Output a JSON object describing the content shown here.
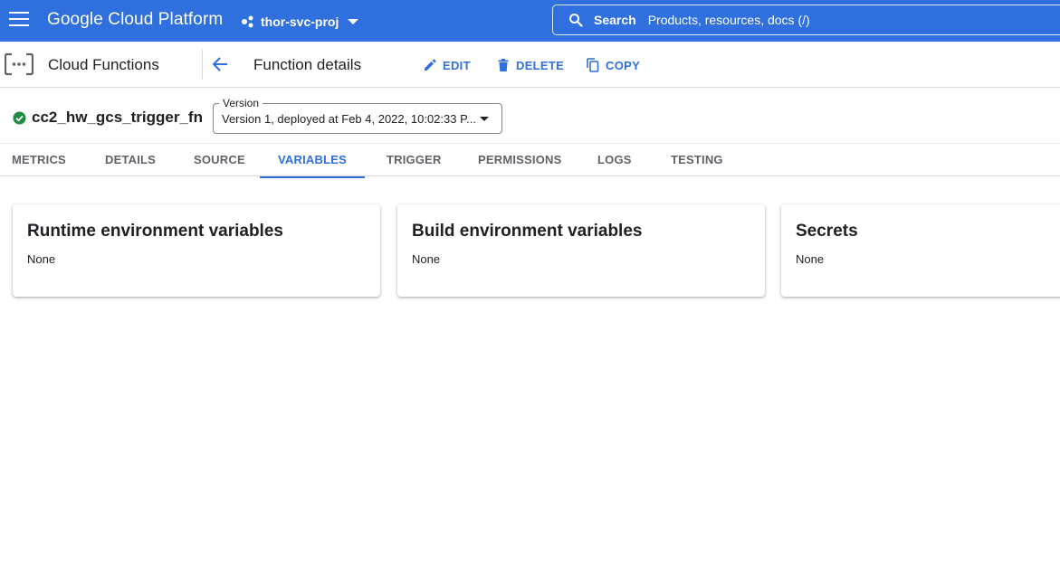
{
  "topbar": {
    "brand": "Google Cloud Platform",
    "project": "thor-svc-proj",
    "search_label": "Search",
    "search_placeholder": "Products, resources, docs (/)"
  },
  "subheader": {
    "product": "Cloud Functions",
    "page_title": "Function details",
    "actions": {
      "edit": "EDIT",
      "delete": "DELETE",
      "copy": "COPY"
    }
  },
  "function": {
    "name": "cc2_hw_gcs_trigger_fn",
    "version_label": "Version",
    "version_value": "Version 1, deployed at Feb 4, 2022, 10:02:33 P..."
  },
  "tabs": [
    "METRICS",
    "DETAILS",
    "SOURCE",
    "VARIABLES",
    "TRIGGER",
    "PERMISSIONS",
    "LOGS",
    "TESTING"
  ],
  "active_tab": "VARIABLES",
  "cards": [
    {
      "title": "Runtime environment variables",
      "value": "None"
    },
    {
      "title": "Build environment variables",
      "value": "None"
    },
    {
      "title": "Secrets",
      "value": "None"
    }
  ],
  "colors": {
    "brand_blue": "#2f6fde",
    "success_green": "#1e8e3e",
    "text": "#202124"
  }
}
